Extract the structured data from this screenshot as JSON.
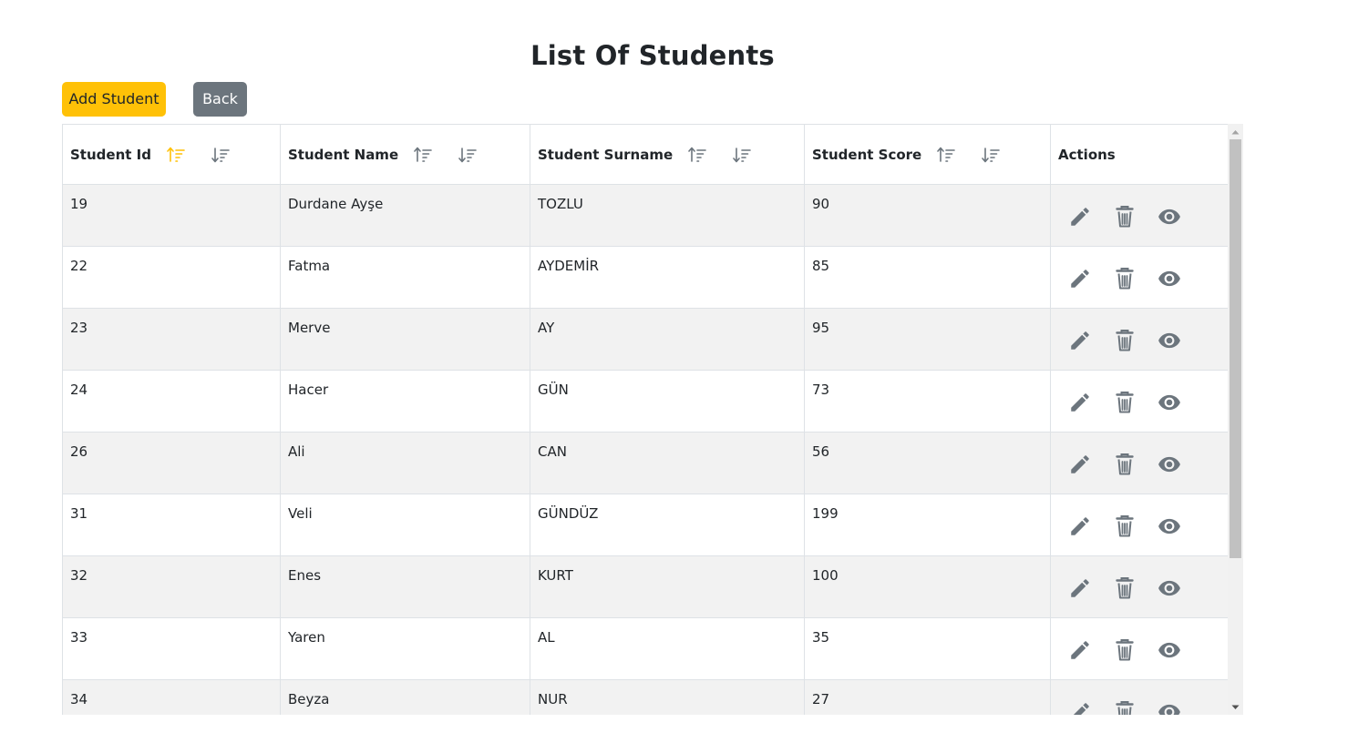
{
  "page": {
    "title": "List Of Students"
  },
  "toolbar": {
    "add_label": "Add Student",
    "back_label": "Back"
  },
  "colors": {
    "add_button": "#ffc107",
    "back_button": "#6c757d",
    "sort_active": "#ffc107",
    "sort_inactive": "#6c757d",
    "action_icon": "#6c757d",
    "stripe": "#f2f2f2"
  },
  "table": {
    "columns": [
      {
        "label": "Student Id",
        "sortable": true,
        "active_sort": "asc"
      },
      {
        "label": "Student Name",
        "sortable": true,
        "active_sort": ""
      },
      {
        "label": "Student Surname",
        "sortable": true,
        "active_sort": ""
      },
      {
        "label": "Student Score",
        "sortable": true,
        "active_sort": ""
      },
      {
        "label": "Actions",
        "sortable": false,
        "active_sort": ""
      }
    ],
    "action_icons": [
      "edit-icon",
      "delete-icon",
      "view-icon"
    ],
    "rows": [
      {
        "id": "19",
        "name": "Durdane Ayşe",
        "surname": "TOZLU",
        "score": "90"
      },
      {
        "id": "22",
        "name": "Fatma",
        "surname": "AYDEMİR",
        "score": "85"
      },
      {
        "id": "23",
        "name": "Merve",
        "surname": "AY",
        "score": "95"
      },
      {
        "id": "24",
        "name": "Hacer",
        "surname": "GÜN",
        "score": "73"
      },
      {
        "id": "26",
        "name": "Ali",
        "surname": "CAN",
        "score": "56"
      },
      {
        "id": "31",
        "name": "Veli",
        "surname": "GÜNDÜZ",
        "score": "199"
      },
      {
        "id": "32",
        "name": "Enes",
        "surname": "KURT",
        "score": "100"
      },
      {
        "id": "33",
        "name": "Yaren",
        "surname": "AL",
        "score": "35"
      },
      {
        "id": "34",
        "name": "Beyza",
        "surname": "NUR",
        "score": "27"
      }
    ]
  }
}
